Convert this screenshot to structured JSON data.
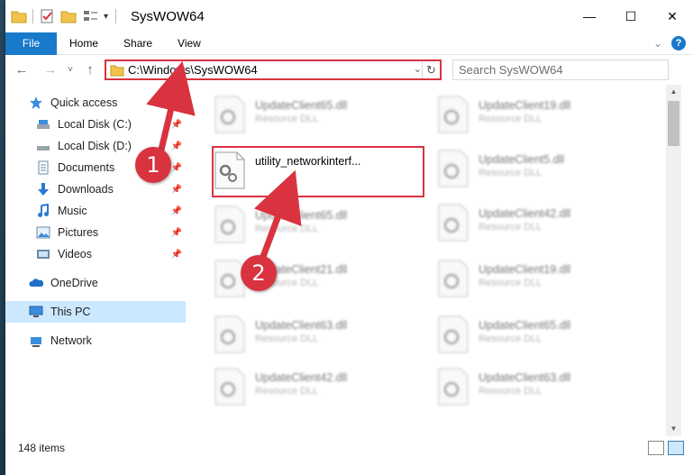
{
  "window": {
    "title": "SysWOW64"
  },
  "qat": {
    "folder_icon": "folder-icon",
    "properties_icon": "properties-icon",
    "new_folder_icon": "new-folder-icon",
    "customize_icon": "customize-icon"
  },
  "window_controls": {
    "minimize": "—",
    "maximize": "☐",
    "close": "✕"
  },
  "ribbon": {
    "tabs": [
      "File",
      "Home",
      "Share",
      "View"
    ],
    "expand": "⌄",
    "help": "?"
  },
  "address": {
    "back": "←",
    "forward": "→",
    "recent": "˅",
    "up": "↑",
    "path": "C:\\Windows\\SysWOW64",
    "dropdown": "⌄",
    "refresh": "↻",
    "search_placeholder": "Search SysWOW64"
  },
  "nav": {
    "items": [
      {
        "label": "Quick access",
        "icon": "star-icon"
      },
      {
        "label": "Local Disk (C:)",
        "icon": "drive-icon",
        "pinned": true
      },
      {
        "label": "Local Disk (D:)",
        "icon": "drive-icon",
        "pinned": true
      },
      {
        "label": "Documents",
        "icon": "documents-icon",
        "pinned": true
      },
      {
        "label": "Downloads",
        "icon": "downloads-icon",
        "pinned": true
      },
      {
        "label": "Music",
        "icon": "music-icon",
        "pinned": true
      },
      {
        "label": "Pictures",
        "icon": "pictures-icon",
        "pinned": true
      },
      {
        "label": "Videos",
        "icon": "videos-icon",
        "pinned": true
      },
      {
        "label": "OneDrive",
        "icon": "onedrive-icon"
      },
      {
        "label": "This PC",
        "icon": "pc-icon",
        "selected": true
      },
      {
        "label": "Network",
        "icon": "network-icon"
      }
    ],
    "pin_glyph": "📌"
  },
  "files": {
    "type_label": "Resource DLL",
    "highlighted": {
      "name": "utility_networkinterf..."
    },
    "left_column": [
      "UpdateClient65.dll",
      "UpdateClient65.dll",
      "UpdateClient21.dll",
      "UpdateClient63.dll",
      "UpdateClient42.dll"
    ],
    "right_column": [
      "UpdateClient19.dll",
      "UpdateClient5.dll",
      "UpdateClient42.dll",
      "UpdateClient19.dll",
      "UpdateClient65.dll",
      "UpdateClient63.dll"
    ]
  },
  "status": {
    "item_count": "148 items"
  },
  "annotations": {
    "step1": "1",
    "step2": "2"
  },
  "colors": {
    "accent": "#1979ca",
    "highlight": "#d9333f",
    "selected": "#cce8ff"
  }
}
